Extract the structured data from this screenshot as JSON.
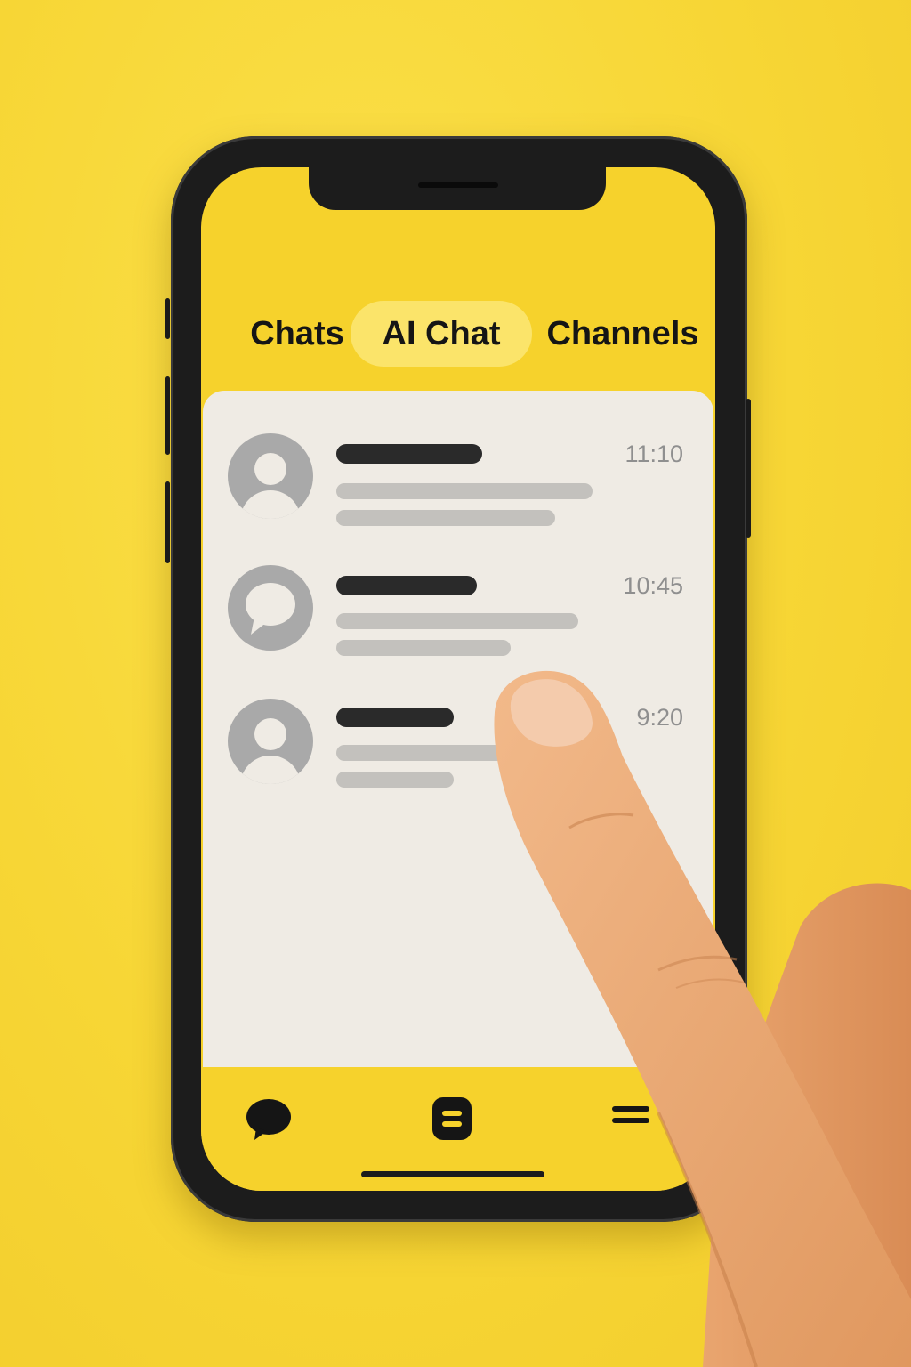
{
  "tabs": [
    {
      "label": "Chats",
      "active": false
    },
    {
      "label": "AI Chat",
      "active": true
    },
    {
      "label": "Channels",
      "active": false
    }
  ],
  "conversations": [
    {
      "avatar": "person-icon",
      "time": "11:10"
    },
    {
      "avatar": "chat-bubble-icon",
      "time": "10:45"
    },
    {
      "avatar": "person-icon",
      "time": "9:20"
    }
  ],
  "bottom_nav": [
    {
      "icon": "chat-bubble-icon"
    },
    {
      "icon": "list-icon"
    },
    {
      "icon": "menu-icon"
    }
  ],
  "colors": {
    "background": "#f7d635",
    "tab_active": "#fbe46a",
    "panel": "#efebe4",
    "placeholder_dark": "#2a2a2a",
    "placeholder_light": "#c3c1bd",
    "avatar": "#a9a9a9"
  }
}
